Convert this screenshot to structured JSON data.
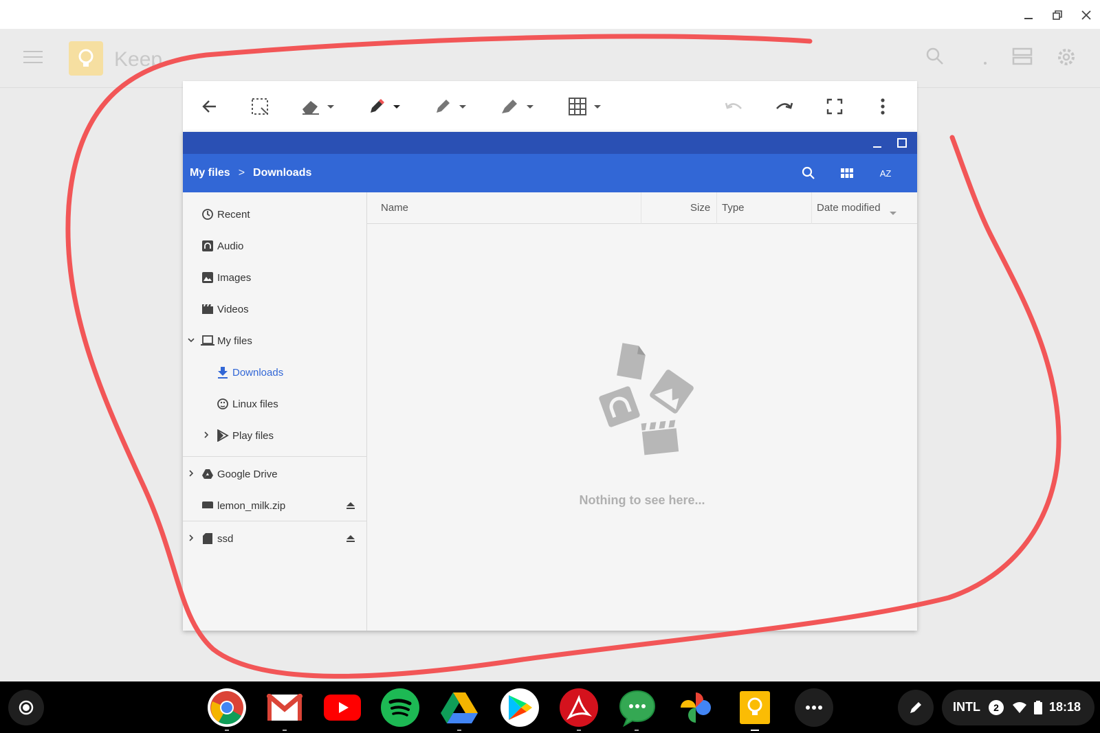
{
  "keep": {
    "title": "Keep"
  },
  "breadcrumb": {
    "root": "My files",
    "separator": ">",
    "current": "Downloads"
  },
  "sort_icon_text": "AZ",
  "nav": {
    "items": [
      {
        "label": "Recent",
        "icon": "clock-icon"
      },
      {
        "label": "Audio",
        "icon": "audio-icon"
      },
      {
        "label": "Images",
        "icon": "image-icon"
      },
      {
        "label": "Videos",
        "icon": "video-icon"
      },
      {
        "label": "My files",
        "icon": "laptop-icon"
      },
      {
        "label": "Downloads",
        "icon": "download-icon"
      },
      {
        "label": "Linux files",
        "icon": "linux-icon"
      },
      {
        "label": "Play files",
        "icon": "play-icon"
      },
      {
        "label": "Google Drive",
        "icon": "drive-icon"
      },
      {
        "label": "lemon_milk.zip",
        "icon": "archive-icon"
      },
      {
        "label": "ssd",
        "icon": "sd-card-icon"
      }
    ]
  },
  "columns": {
    "name": "Name",
    "size": "Size",
    "type": "Type",
    "date": "Date modified"
  },
  "empty_message": "Nothing to see here...",
  "tray": {
    "input_method": "INTL",
    "notification_count": "2",
    "time": "18:18"
  },
  "colors": {
    "title_bar": "#2a50b4",
    "header": "#3267d6",
    "annotation_stroke": "#f25657",
    "active_nav": "#3267d6"
  },
  "shelf_apps": [
    "chrome-icon",
    "gmail-icon",
    "youtube-icon",
    "spotify-icon",
    "drive-icon",
    "play-store-icon",
    "acrobat-icon",
    "messages-icon",
    "photos-icon",
    "keep-icon",
    "more-icon"
  ]
}
